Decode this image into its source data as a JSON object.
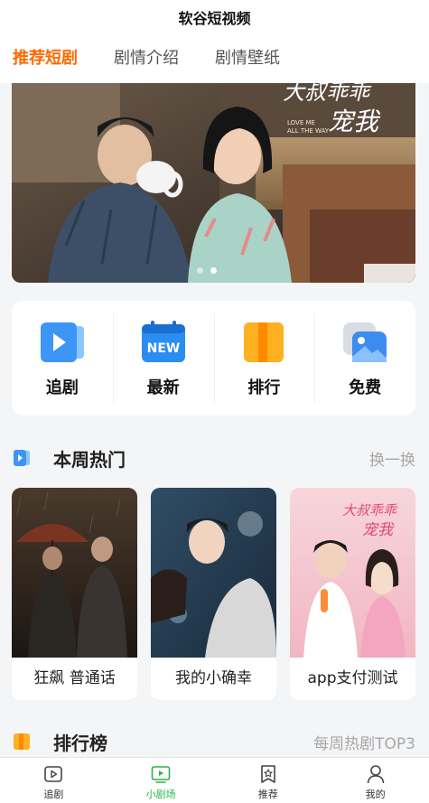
{
  "app": {
    "title": "软谷短视频"
  },
  "tabs": [
    {
      "label": "推荐短剧",
      "active": true
    },
    {
      "label": "剧情介绍",
      "active": false
    },
    {
      "label": "剧情壁纸",
      "active": false
    }
  ],
  "banner": {
    "poster_text": "大叔乖乖宠我",
    "poster_subtext": "LOVE ME ALL THE WAY",
    "slide_count": 2,
    "active_slide": 2
  },
  "quick_entries": [
    {
      "label": "追剧",
      "icon": "play-video-icon"
    },
    {
      "label": "最新",
      "icon": "new-calendar-icon"
    },
    {
      "label": "排行",
      "icon": "ranking-book-icon"
    },
    {
      "label": "免费",
      "icon": "free-image-icon"
    }
  ],
  "hot_section": {
    "title": "本周热门",
    "more": "换一换"
  },
  "hot_items": [
    {
      "title": "狂飙 普通话"
    },
    {
      "title": "我的小确幸"
    },
    {
      "title": "app支付测试"
    }
  ],
  "rank_section": {
    "title": "排行榜",
    "more": "每周热剧TOP3"
  },
  "tabbar": [
    {
      "label": "追剧",
      "icon": "play-square-icon",
      "active": false
    },
    {
      "label": "小剧场",
      "icon": "tv-icon",
      "active": true
    },
    {
      "label": "推荐",
      "icon": "star-badge-icon",
      "active": false
    },
    {
      "label": "我的",
      "icon": "user-icon",
      "active": false
    }
  ],
  "colors": {
    "accent": "#ff6a00",
    "active_tab": "#2ab449",
    "muted": "#a7a7a7",
    "background": "#f4f5f7"
  }
}
